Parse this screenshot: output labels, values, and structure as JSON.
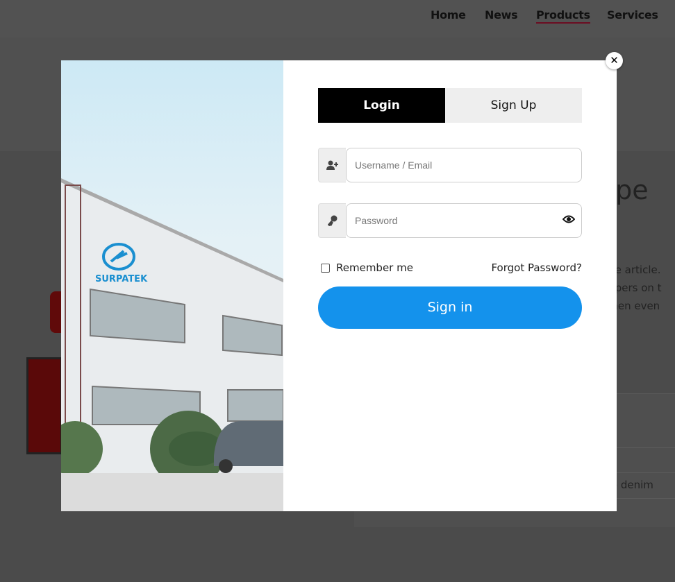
{
  "nav": {
    "items": [
      {
        "label": "Home"
      },
      {
        "label": "News"
      },
      {
        "label": "Products",
        "active": true
      },
      {
        "label": "Services"
      }
    ]
  },
  "background": {
    "title_fragment": "ripe",
    "text_fragments": [
      "ine article.",
      "ippers on t",
      "linen even"
    ],
    "table_fragment": "e to denim"
  },
  "modal": {
    "image_logo_text": "SURPATEK",
    "close_icon": "close-icon",
    "tabs": [
      {
        "label": "Login",
        "active": true
      },
      {
        "label": "Sign Up",
        "active": false
      }
    ],
    "username": {
      "placeholder": "Username / Email",
      "value": "",
      "icon": "user-plus-icon"
    },
    "password": {
      "placeholder": "Password",
      "value": "",
      "icon": "key-icon",
      "toggle_icon": "eye-icon"
    },
    "remember_label": "Remember me",
    "remember_checked": false,
    "forgot_label": "Forgot Password?",
    "signin_label": "Sign in",
    "colors": {
      "primary": "#1492ec",
      "tab_active": "#000000",
      "tab_inactive": "#eeeeee",
      "nav_active_underline": "#6b0d22"
    }
  }
}
